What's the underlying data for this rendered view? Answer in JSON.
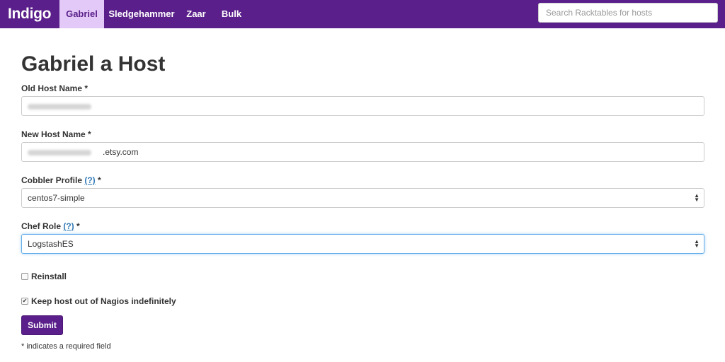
{
  "navbar": {
    "brand": "Indigo",
    "items": [
      {
        "label": "Gabriel",
        "active": true
      },
      {
        "label": "Sledgehammer",
        "active": false
      },
      {
        "label": "Zaar",
        "active": false
      },
      {
        "label": "Bulk",
        "active": false
      }
    ],
    "search_placeholder": "Search Racktables for hosts"
  },
  "page": {
    "title": "Gabriel a Host"
  },
  "form": {
    "old_host_name": {
      "label": "Old Host Name",
      "required_mark": "*"
    },
    "new_host_name": {
      "label": "New Host Name",
      "required_mark": "*",
      "domain_suffix": ".etsy.com"
    },
    "cobbler_profile": {
      "label": "Cobbler Profile",
      "help": "(?)",
      "required_mark": "*",
      "value": "centos7-simple"
    },
    "chef_role": {
      "label": "Chef Role",
      "help": "(?)",
      "required_mark": "*",
      "value": "LogstashES"
    },
    "reinstall": {
      "label": "Reinstall",
      "checked": false
    },
    "keep_out_nagios": {
      "label": "Keep host out of Nagios indefinitely",
      "checked": true
    },
    "submit_label": "Submit",
    "footnote": "* indicates a required field"
  },
  "colors": {
    "navbar_bg": "#5a1f8a",
    "active_tab_bg": "#e3c9f7",
    "help_link": "#337ab7"
  }
}
